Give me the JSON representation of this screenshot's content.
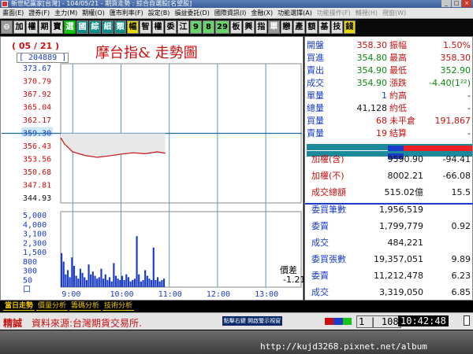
{
  "window": {
    "title": "新世紀贏家[台灣] - 104/05/21 - 期貨走勢 : 綜合自選股[名望股]"
  },
  "menu": [
    "畫面(E)",
    "證券(F)",
    "主力(M)",
    "期權(O)",
    "匯市利率(F)",
    "設定(B)",
    "損益委託(D)",
    "國際資訊(I)",
    "金融(X)",
    "功能選擇(A)",
    "功能操作(F)",
    "輔視(H)",
    "視窗(W)"
  ],
  "toolbar": [
    {
      "label": "⊖",
      "style": "gray"
    },
    {
      "label": "加",
      "style": ""
    },
    {
      "label": "權",
      "style": ""
    },
    {
      "label": "期",
      "style": ""
    },
    {
      "label": "寶",
      "style": ""
    },
    {
      "label": "選",
      "style": "green"
    },
    {
      "label": "國",
      "style": "teal"
    },
    {
      "label": "綜",
      "style": "teal"
    },
    {
      "label": "細",
      "style": "teal"
    },
    {
      "label": "類",
      "style": "teal"
    },
    {
      "label": "幅",
      "style": "yellow"
    },
    {
      "label": "智",
      "style": ""
    },
    {
      "label": "權",
      "style": ""
    },
    {
      "label": "委",
      "style": ""
    },
    {
      "label": "江",
      "style": ""
    },
    {
      "label": "9",
      "style": "lgreen"
    },
    {
      "label": "8",
      "style": "lgreen"
    },
    {
      "label": "29",
      "style": "lgreen"
    },
    {
      "label": "板",
      "style": ""
    },
    {
      "label": "興",
      "style": ""
    },
    {
      "label": "指",
      "style": ""
    },
    {
      "label": "單",
      "style": "gray"
    },
    {
      "label": "戀",
      "style": ""
    },
    {
      "label": "產",
      "style": ""
    },
    {
      "label": "額",
      "style": ""
    },
    {
      "label": "基",
      "style": ""
    },
    {
      "label": "技",
      "style": ""
    },
    {
      "label": "錢",
      "style": "yellow"
    }
  ],
  "chart": {
    "date": "( 05 / 21 )",
    "volume_code": "[ 204889 ]",
    "title": "摩台指&  走勢圖",
    "diff_label": "價差",
    "diff_value": "-1.21"
  },
  "chart_data": {
    "type": "line",
    "title": "摩台指&  走勢圖",
    "price_ticks": [
      "373.67",
      "370.79",
      "367.92",
      "365.04",
      "362.17",
      "359.30",
      "356.43",
      "353.56",
      "350.68",
      "347.81",
      "344.93"
    ],
    "reference_price": 359.3,
    "price_range": [
      344.93,
      373.67
    ],
    "x_ticks": [
      "9:00",
      "10:00",
      "11:00",
      "12:00",
      "13:00"
    ],
    "volume_ticks": [
      "5,000",
      "4,000",
      "3,100",
      "2,300",
      "1,500",
      "800",
      "300",
      "50",
      "口"
    ],
    "price_series": {
      "x": [
        "08:45",
        "08:50",
        "09:00",
        "09:15",
        "09:30",
        "09:45",
        "10:00",
        "10:15",
        "10:30",
        "10:45",
        "10:55"
      ],
      "y": [
        358.3,
        356.9,
        355.2,
        354.4,
        354.0,
        354.3,
        354.7,
        355.0,
        354.8,
        355.2,
        354.9
      ]
    },
    "volume_series": {
      "x_start": "08:45",
      "x_end": "10:55",
      "values": [
        2400,
        1800,
        900,
        1200,
        700,
        2100,
        1500,
        800,
        600,
        1300,
        1000,
        700,
        500,
        1600,
        900,
        1100,
        800,
        600,
        700,
        1300,
        600,
        900,
        500,
        700,
        400,
        1700,
        800,
        600,
        500,
        800,
        500,
        900,
        700,
        400,
        500,
        600,
        3600,
        900,
        400,
        500,
        1200,
        800,
        600,
        500,
        2800,
        500,
        700,
        400,
        500,
        600
      ]
    }
  },
  "quote": [
    {
      "l1": "開盤",
      "v1": "358.30",
      "c1": "red",
      "l2": "振幅",
      "v2": "1.50%",
      "c2": "red"
    },
    {
      "l1": "買進",
      "v1": "354.80",
      "c1": "green",
      "l2": "最高",
      "v2": "358.30",
      "c2": "red"
    },
    {
      "l1": "賣出",
      "v1": "354.90",
      "c1": "green",
      "l2": "最低",
      "v2": "352.90",
      "c2": "green"
    },
    {
      "l1": "成交",
      "v1": "354.90",
      "c1": "green",
      "l2": "漲跌",
      "v2": "-4.40(1²²)",
      "c2": "green"
    },
    {
      "l1": "單量",
      "v1": "1",
      "c1": "blue",
      "l2": "約高",
      "v2": "-",
      "c2": "black"
    },
    {
      "l1": "總量",
      "v1": "41,128",
      "c1": "black",
      "l2": "約低",
      "v2": "-",
      "c2": "black"
    },
    {
      "l1": "買量",
      "v1": "68",
      "c1": "red",
      "l2": "未平倉",
      "v2": "191,867",
      "c2": "red"
    },
    {
      "l1": "賣量",
      "v1": "19",
      "c1": "red",
      "l2": "結算",
      "v2": "-",
      "c2": "black"
    }
  ],
  "indices": [
    {
      "label": "加權(含)",
      "value": "9590.90",
      "change": "-94.41"
    },
    {
      "label": "加權(不)",
      "value": "8002.21",
      "change": "-66.08"
    },
    {
      "label": "成交總額",
      "value": "515.02億",
      "change": "15.5"
    }
  ],
  "orders": [
    {
      "label": "委買筆數",
      "value": "1,956,519",
      "change": ""
    },
    {
      "label": "委賣",
      "value": "1,799,779",
      "change": "0.92"
    },
    {
      "label": "成交",
      "value": "484,221",
      "change": ""
    },
    {
      "label": "委買張數",
      "value": "19,357,051",
      "change": "9.89"
    },
    {
      "label": "委賣",
      "value": "11,212,478",
      "change": "6.23"
    },
    {
      "label": "成交",
      "value": "3,319,050",
      "change": "6.85"
    }
  ],
  "tabs": [
    "當日走勢",
    "價量分析",
    "籌碼分析",
    "技術分析"
  ],
  "status": {
    "left": "精誠",
    "message": "資料來源:台灣期貨交易所.",
    "button": "點擊右鍵 開啟警示視窗",
    "count": "1 | 108",
    "time": "10:42:48",
    "colors": [
      "#c81010",
      "#1a3cc8",
      "#19c219"
    ]
  },
  "watermark": "http://kujd3268.pixnet.net/album"
}
